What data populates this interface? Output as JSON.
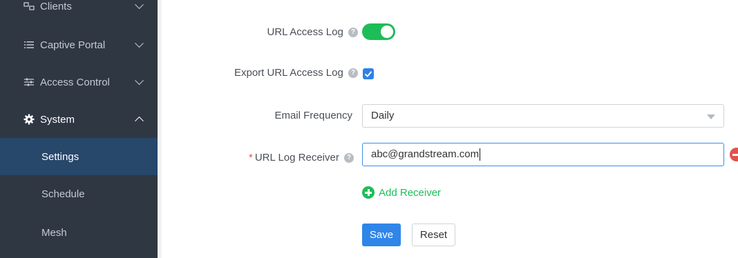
{
  "sidebar": {
    "items": [
      {
        "label": "Clients",
        "icon": "clients-icon"
      },
      {
        "label": "Captive Portal",
        "icon": "list-icon"
      },
      {
        "label": "Access Control",
        "icon": "sliders-icon"
      },
      {
        "label": "System",
        "icon": "gear-icon"
      }
    ],
    "subitems": [
      {
        "label": "Settings"
      },
      {
        "label": "Schedule"
      },
      {
        "label": "Mesh"
      }
    ]
  },
  "form": {
    "url_access_log_label": "URL Access Log",
    "url_access_log_enabled": true,
    "export_url_access_log_label": "Export URL Access Log",
    "export_url_access_log_checked": true,
    "email_frequency_label": "Email Frequency",
    "email_frequency_value": "Daily",
    "url_log_receiver_required": "*",
    "url_log_receiver_label": "URL Log Receiver",
    "url_log_receiver_value": "abc@grandstream.com",
    "add_receiver_label": "Add Receiver",
    "help_glyph": "?"
  },
  "buttons": {
    "save_label": "Save",
    "reset_label": "Reset"
  },
  "colors": {
    "sidebar_bg": "#2f3743",
    "sidebar_active_bg": "#27476b",
    "toggle_on": "#1dbd58",
    "primary": "#2f86e8",
    "danger": "#e2524b"
  }
}
